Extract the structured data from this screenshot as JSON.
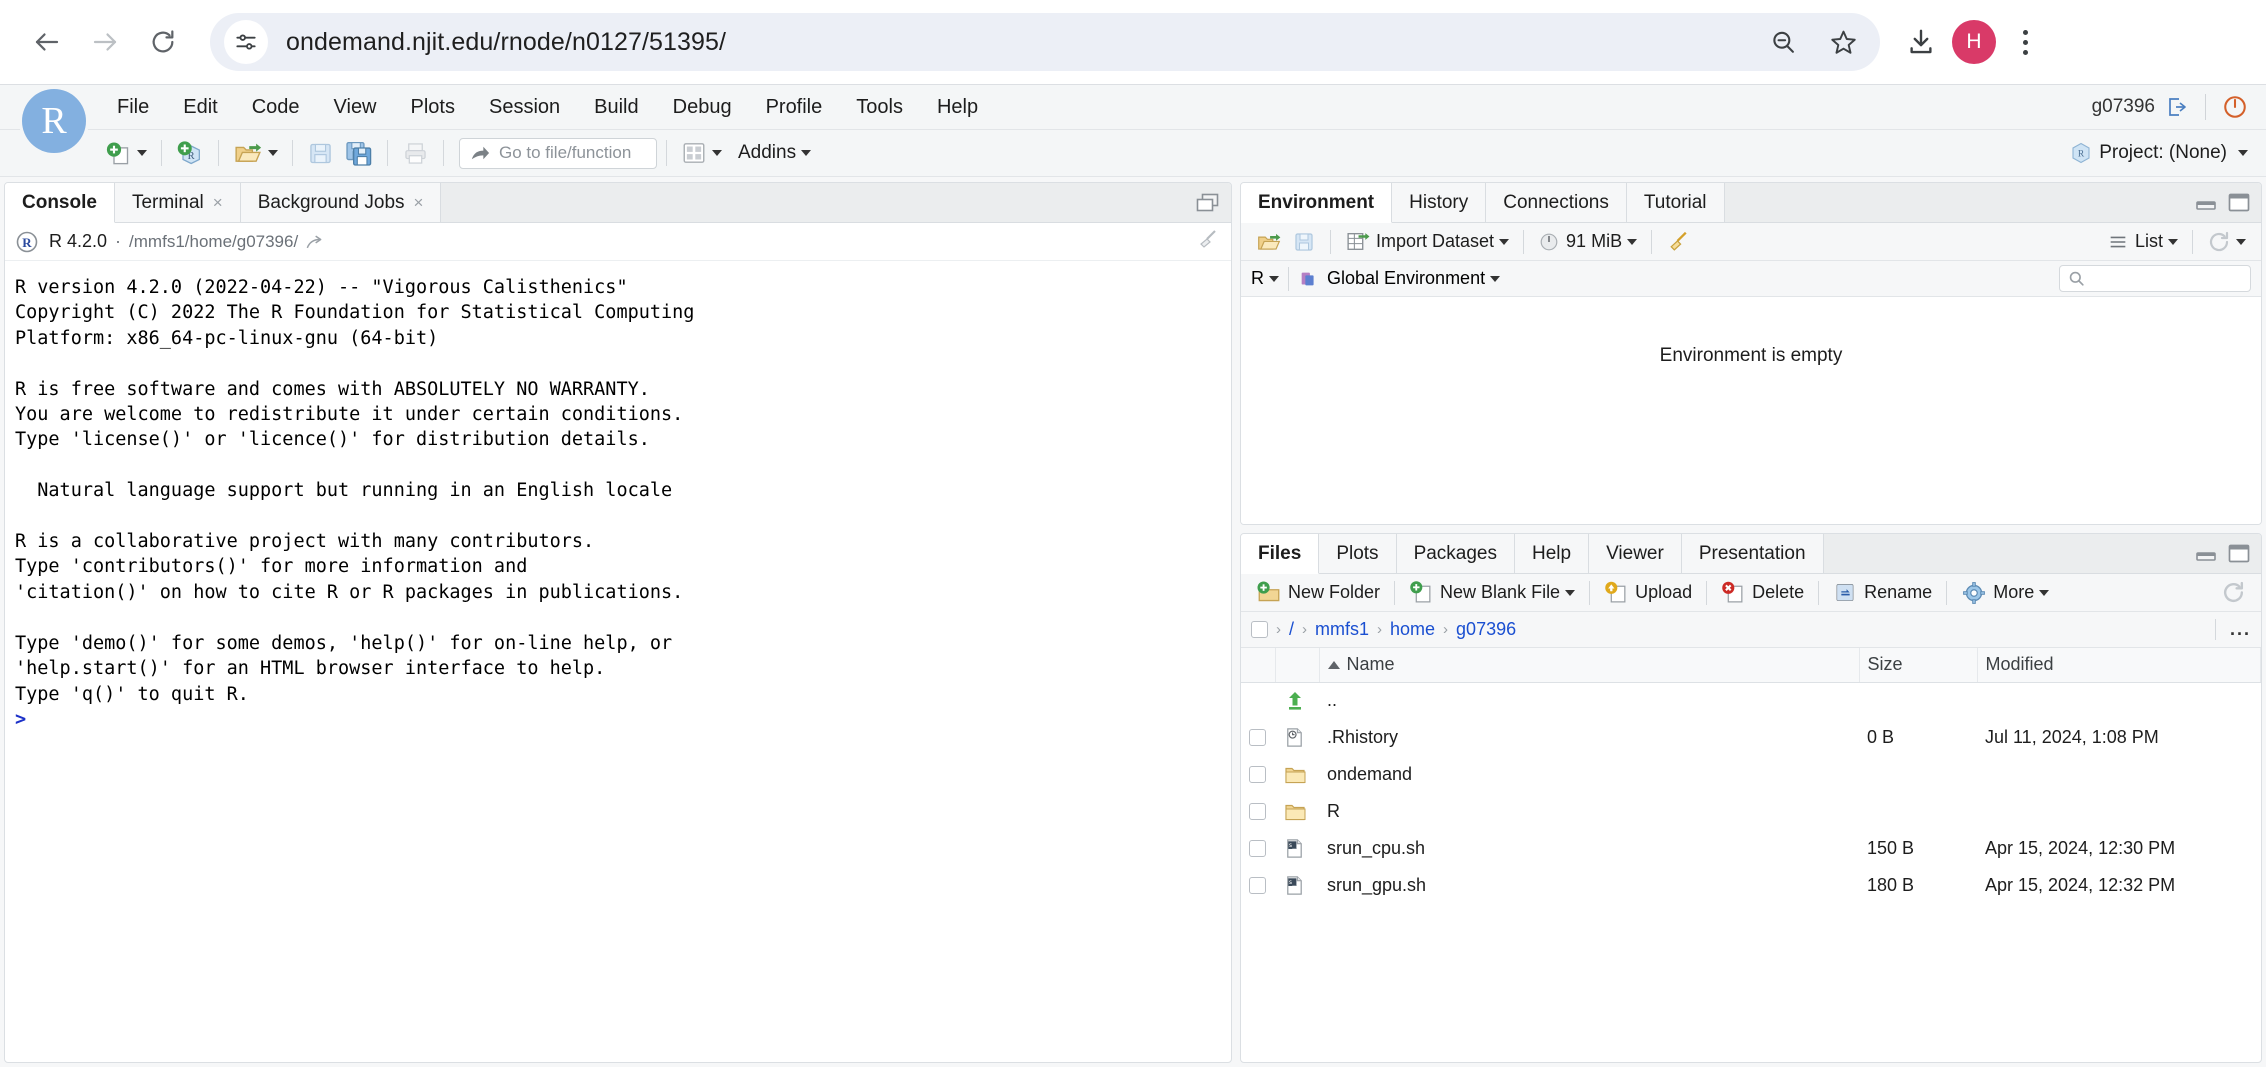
{
  "browser": {
    "back_label": "Back",
    "forward_label": "Forward",
    "reload_label": "Reload",
    "site_info_icon": "tune-site-settings-icon",
    "url": "ondemand.njit.edu/rnode/n0127/51395/",
    "zoom_out_icon": "zoom-out-icon",
    "bookmark_icon": "star-icon",
    "download_icon": "download-icon",
    "avatar_letter": "H",
    "avatar_color": "#d93a68",
    "menu_icon": "kebab-menu-icon"
  },
  "rstudio": {
    "logo_letter": "R",
    "menus": [
      "File",
      "Edit",
      "Code",
      "View",
      "Plots",
      "Session",
      "Build",
      "Debug",
      "Profile",
      "Tools",
      "Help"
    ],
    "username": "g07396",
    "signout_icon": "sign-out-icon",
    "quit_icon": "power-quit-icon",
    "project_label": "Project: (None)",
    "toolbar": {
      "new_file_icon": "new-file-icon",
      "new_project_icon": "new-project-icon",
      "open_file_icon": "open-folder-icon",
      "save_icon": "save-icon",
      "save_all_icon": "save-all-icon",
      "print_icon": "print-icon",
      "goto_icon": "goto-arrow-icon",
      "goto_placeholder": "Go to file/function",
      "panes_icon": "workspace-panes-icon",
      "addins_label": "Addins"
    }
  },
  "console_pane": {
    "tabs": [
      {
        "label": "Console",
        "active": true,
        "closable": false
      },
      {
        "label": "Terminal",
        "active": false,
        "closable": true
      },
      {
        "label": "Background Jobs",
        "active": false,
        "closable": true
      }
    ],
    "maximize_icon": "restore-pane-icon",
    "r_version": "R 4.2.0",
    "separator": "·",
    "working_dir": "/mmfs1/home/g07396/",
    "wd_link_icon": "open-in-new-icon",
    "broom_icon": "clear-console-broom-icon",
    "output": "R version 4.2.0 (2022-04-22) -- \"Vigorous Calisthenics\"\nCopyright (C) 2022 The R Foundation for Statistical Computing\nPlatform: x86_64-pc-linux-gnu (64-bit)\n\nR is free software and comes with ABSOLUTELY NO WARRANTY.\nYou are welcome to redistribute it under certain conditions.\nType 'license()' or 'licence()' for distribution details.\n\n  Natural language support but running in an English locale\n\nR is a collaborative project with many contributors.\nType 'contributors()' for more information and\n'citation()' on how to cite R or R packages in publications.\n\nType 'demo()' for some demos, 'help()' for on-line help, or\n'help.start()' for an HTML browser interface to help.\nType 'q()' to quit R.\n",
    "prompt": ">"
  },
  "environment_pane": {
    "tabs": [
      {
        "label": "Environment",
        "active": true
      },
      {
        "label": "History",
        "active": false
      },
      {
        "label": "Connections",
        "active": false
      },
      {
        "label": "Tutorial",
        "active": false
      }
    ],
    "minimize_icon": "minimize-pane-icon",
    "maximize_icon": "maximize-pane-icon",
    "toolbar": {
      "load_icon": "load-workspace-icon",
      "save_icon": "save-workspace-icon",
      "import_dataset_icon": "import-dataset-icon",
      "import_dataset_label": "Import Dataset",
      "memory_icon": "memory-gauge-icon",
      "memory_label": "91 MiB",
      "broom_icon": "clear-objects-broom-icon",
      "list_view_icon": "list-view-icon",
      "list_label": "List",
      "refresh_icon": "refresh-icon"
    },
    "scope": {
      "language_label": "R",
      "environment_icon": "global-environment-icon",
      "environment_label": "Global Environment",
      "search_icon": "search-icon",
      "search_placeholder": "",
      "search_value": ""
    },
    "empty_message": "Environment is empty"
  },
  "files_pane": {
    "tabs": [
      {
        "label": "Files",
        "active": true
      },
      {
        "label": "Plots",
        "active": false
      },
      {
        "label": "Packages",
        "active": false
      },
      {
        "label": "Help",
        "active": false
      },
      {
        "label": "Viewer",
        "active": false
      },
      {
        "label": "Presentation",
        "active": false
      }
    ],
    "minimize_icon": "minimize-pane-icon",
    "maximize_icon": "maximize-pane-icon",
    "toolbar": {
      "new_folder_icon": "new-folder-icon",
      "new_folder_label": "New Folder",
      "new_blank_file_icon": "new-blank-file-icon",
      "new_blank_file_label": "New Blank File",
      "upload_icon": "upload-icon",
      "upload_label": "Upload",
      "delete_icon": "delete-icon",
      "delete_label": "Delete",
      "rename_icon": "rename-icon",
      "rename_label": "Rename",
      "more_icon": "more-gear-icon",
      "more_label": "More",
      "refresh_icon": "refresh-icon"
    },
    "breadcrumb": {
      "home_icon": "home-checkbox-icon",
      "items": [
        "/",
        "mmfs1",
        "home",
        "g07396"
      ],
      "overflow_label": "..."
    },
    "columns": [
      "",
      "",
      "Name",
      "Size",
      "Modified"
    ],
    "sort_column": "Name",
    "sort_direction": "ascending",
    "rows": [
      {
        "checkbox": false,
        "icon": "up-arrow-parent-icon",
        "name": "..",
        "size": "",
        "modified": "",
        "has_checkbox": false
      },
      {
        "checkbox": false,
        "icon": "history-file-icon",
        "name": ".Rhistory",
        "size": "0 B",
        "modified": "Jul 11, 2024, 1:08 PM",
        "has_checkbox": true
      },
      {
        "checkbox": false,
        "icon": "folder-icon",
        "name": "ondemand",
        "size": "",
        "modified": "",
        "has_checkbox": true
      },
      {
        "checkbox": false,
        "icon": "folder-icon",
        "name": "R",
        "size": "",
        "modified": "",
        "has_checkbox": true
      },
      {
        "checkbox": false,
        "icon": "shell-script-icon",
        "name": "srun_cpu.sh",
        "size": "150 B",
        "modified": "Apr 15, 2024, 12:30 PM",
        "has_checkbox": true
      },
      {
        "checkbox": false,
        "icon": "shell-script-icon",
        "name": "srun_gpu.sh",
        "size": "180 B",
        "modified": "Apr 15, 2024, 12:32 PM",
        "has_checkbox": true
      }
    ]
  }
}
